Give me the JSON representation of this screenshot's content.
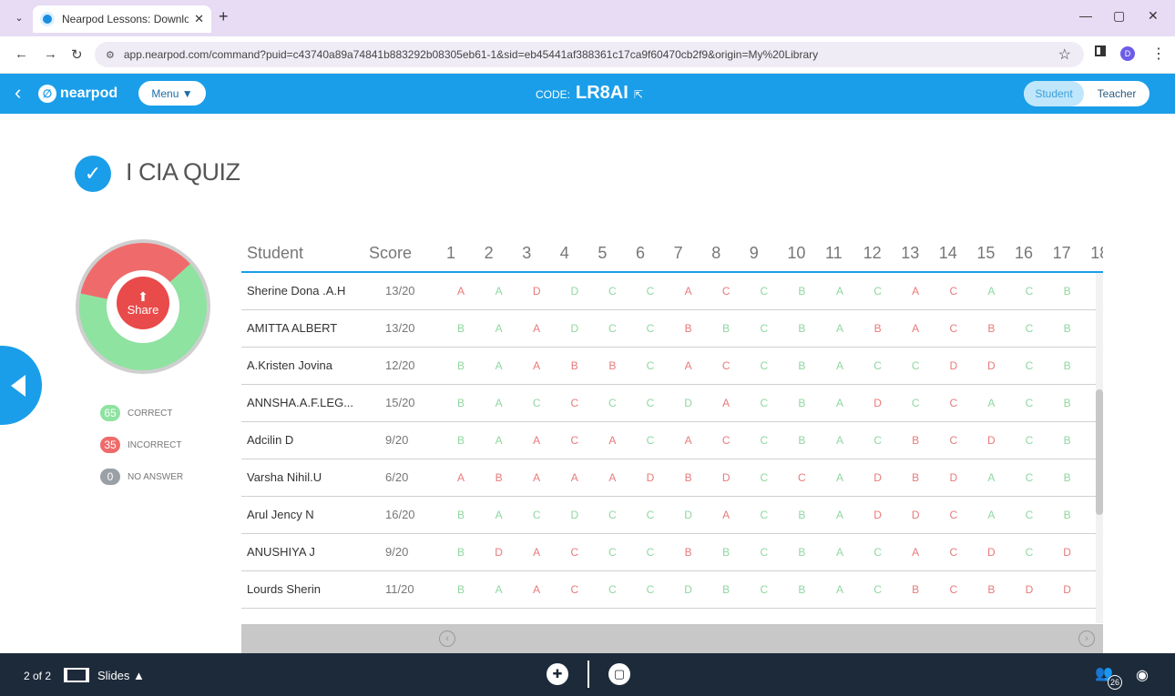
{
  "browser": {
    "tab_title": "Nearpod Lessons: Download re",
    "url": "app.nearpod.com/command?puid=c43740a89a74841b883292b08305eb61-1&sid=eb45441af388361c17ca9f60470cb2f9&origin=My%20Library",
    "profile_initial": "D"
  },
  "header": {
    "logo_text": "nearpod",
    "menu_label": "Menu ▼",
    "code_label": "CODE:",
    "code_value": "LR8AI",
    "mode_student": "Student",
    "mode_teacher": "Teacher"
  },
  "quiz": {
    "title": "I CIA QUIZ",
    "share_label": "Share",
    "stats": {
      "correct_count": "65",
      "correct_label": "CORRECT",
      "incorrect_count": "35",
      "incorrect_label": "INCORRECT",
      "no_answer_count": "0",
      "no_answer_label": "NO ANSWER"
    },
    "colors": {
      "correct": "#8ee3a0",
      "incorrect": "#ef6b6b",
      "no_answer": "#9aa0a6"
    }
  },
  "table": {
    "col_student": "Student",
    "col_score": "Score",
    "questions": [
      "1",
      "2",
      "3",
      "4",
      "5",
      "6",
      "7",
      "8",
      "9",
      "10",
      "11",
      "12",
      "13",
      "14",
      "15",
      "16",
      "17",
      "18"
    ],
    "rows": [
      {
        "name": "Sherine Dona .A.H",
        "score": "13/20",
        "answers": [
          {
            "a": "A",
            "ok": false
          },
          {
            "a": "A",
            "ok": true
          },
          {
            "a": "D",
            "ok": false
          },
          {
            "a": "D",
            "ok": true
          },
          {
            "a": "C",
            "ok": true
          },
          {
            "a": "C",
            "ok": true
          },
          {
            "a": "A",
            "ok": false
          },
          {
            "a": "C",
            "ok": false
          },
          {
            "a": "C",
            "ok": true
          },
          {
            "a": "B",
            "ok": true
          },
          {
            "a": "A",
            "ok": true
          },
          {
            "a": "C",
            "ok": true
          },
          {
            "a": "A",
            "ok": false
          },
          {
            "a": "C",
            "ok": false
          },
          {
            "a": "A",
            "ok": true
          },
          {
            "a": "C",
            "ok": true
          },
          {
            "a": "B",
            "ok": true
          }
        ]
      },
      {
        "name": "AMITTA ALBERT",
        "score": "13/20",
        "answers": [
          {
            "a": "B",
            "ok": true
          },
          {
            "a": "A",
            "ok": true
          },
          {
            "a": "A",
            "ok": false
          },
          {
            "a": "D",
            "ok": true
          },
          {
            "a": "C",
            "ok": true
          },
          {
            "a": "C",
            "ok": true
          },
          {
            "a": "B",
            "ok": false
          },
          {
            "a": "B",
            "ok": true
          },
          {
            "a": "C",
            "ok": true
          },
          {
            "a": "B",
            "ok": true
          },
          {
            "a": "A",
            "ok": true
          },
          {
            "a": "B",
            "ok": false
          },
          {
            "a": "A",
            "ok": false
          },
          {
            "a": "C",
            "ok": false
          },
          {
            "a": "B",
            "ok": false
          },
          {
            "a": "C",
            "ok": true
          },
          {
            "a": "B",
            "ok": true
          }
        ]
      },
      {
        "name": "A.Kristen Jovina",
        "score": "12/20",
        "answers": [
          {
            "a": "B",
            "ok": true
          },
          {
            "a": "A",
            "ok": true
          },
          {
            "a": "A",
            "ok": false
          },
          {
            "a": "B",
            "ok": false
          },
          {
            "a": "B",
            "ok": false
          },
          {
            "a": "C",
            "ok": true
          },
          {
            "a": "A",
            "ok": false
          },
          {
            "a": "C",
            "ok": false
          },
          {
            "a": "C",
            "ok": true
          },
          {
            "a": "B",
            "ok": true
          },
          {
            "a": "A",
            "ok": true
          },
          {
            "a": "C",
            "ok": true
          },
          {
            "a": "C",
            "ok": true
          },
          {
            "a": "D",
            "ok": false
          },
          {
            "a": "D",
            "ok": false
          },
          {
            "a": "C",
            "ok": true
          },
          {
            "a": "B",
            "ok": true
          }
        ]
      },
      {
        "name": "ANNSHA.A.F.LEG...",
        "score": "15/20",
        "answers": [
          {
            "a": "B",
            "ok": true
          },
          {
            "a": "A",
            "ok": true
          },
          {
            "a": "C",
            "ok": true
          },
          {
            "a": "C",
            "ok": false
          },
          {
            "a": "C",
            "ok": true
          },
          {
            "a": "C",
            "ok": true
          },
          {
            "a": "D",
            "ok": true
          },
          {
            "a": "A",
            "ok": false
          },
          {
            "a": "C",
            "ok": true
          },
          {
            "a": "B",
            "ok": true
          },
          {
            "a": "A",
            "ok": true
          },
          {
            "a": "D",
            "ok": false
          },
          {
            "a": "C",
            "ok": true
          },
          {
            "a": "C",
            "ok": false
          },
          {
            "a": "A",
            "ok": true
          },
          {
            "a": "C",
            "ok": true
          },
          {
            "a": "B",
            "ok": true
          }
        ]
      },
      {
        "name": "Adcilin D",
        "score": "9/20",
        "answers": [
          {
            "a": "B",
            "ok": true
          },
          {
            "a": "A",
            "ok": true
          },
          {
            "a": "A",
            "ok": false
          },
          {
            "a": "C",
            "ok": false
          },
          {
            "a": "A",
            "ok": false
          },
          {
            "a": "C",
            "ok": true
          },
          {
            "a": "A",
            "ok": false
          },
          {
            "a": "C",
            "ok": false
          },
          {
            "a": "C",
            "ok": true
          },
          {
            "a": "B",
            "ok": true
          },
          {
            "a": "A",
            "ok": true
          },
          {
            "a": "C",
            "ok": true
          },
          {
            "a": "B",
            "ok": false
          },
          {
            "a": "C",
            "ok": false
          },
          {
            "a": "D",
            "ok": false
          },
          {
            "a": "C",
            "ok": true
          },
          {
            "a": "B",
            "ok": true
          }
        ]
      },
      {
        "name": "Varsha Nihil.U",
        "score": "6/20",
        "answers": [
          {
            "a": "A",
            "ok": false
          },
          {
            "a": "B",
            "ok": false
          },
          {
            "a": "A",
            "ok": false
          },
          {
            "a": "A",
            "ok": false
          },
          {
            "a": "A",
            "ok": false
          },
          {
            "a": "D",
            "ok": false
          },
          {
            "a": "B",
            "ok": false
          },
          {
            "a": "D",
            "ok": false
          },
          {
            "a": "C",
            "ok": true
          },
          {
            "a": "C",
            "ok": false
          },
          {
            "a": "A",
            "ok": true
          },
          {
            "a": "D",
            "ok": false
          },
          {
            "a": "B",
            "ok": false
          },
          {
            "a": "D",
            "ok": false
          },
          {
            "a": "A",
            "ok": true
          },
          {
            "a": "C",
            "ok": true
          },
          {
            "a": "B",
            "ok": true
          }
        ]
      },
      {
        "name": "Arul Jency N",
        "score": "16/20",
        "answers": [
          {
            "a": "B",
            "ok": true
          },
          {
            "a": "A",
            "ok": true
          },
          {
            "a": "C",
            "ok": true
          },
          {
            "a": "D",
            "ok": true
          },
          {
            "a": "C",
            "ok": true
          },
          {
            "a": "C",
            "ok": true
          },
          {
            "a": "D",
            "ok": true
          },
          {
            "a": "A",
            "ok": false
          },
          {
            "a": "C",
            "ok": true
          },
          {
            "a": "B",
            "ok": true
          },
          {
            "a": "A",
            "ok": true
          },
          {
            "a": "D",
            "ok": false
          },
          {
            "a": "D",
            "ok": false
          },
          {
            "a": "C",
            "ok": false
          },
          {
            "a": "A",
            "ok": true
          },
          {
            "a": "C",
            "ok": true
          },
          {
            "a": "B",
            "ok": true
          }
        ]
      },
      {
        "name": "ANUSHIYA J",
        "score": "9/20",
        "answers": [
          {
            "a": "B",
            "ok": true
          },
          {
            "a": "D",
            "ok": false
          },
          {
            "a": "A",
            "ok": false
          },
          {
            "a": "C",
            "ok": false
          },
          {
            "a": "C",
            "ok": true
          },
          {
            "a": "C",
            "ok": true
          },
          {
            "a": "B",
            "ok": false
          },
          {
            "a": "B",
            "ok": true
          },
          {
            "a": "C",
            "ok": true
          },
          {
            "a": "B",
            "ok": true
          },
          {
            "a": "A",
            "ok": true
          },
          {
            "a": "C",
            "ok": true
          },
          {
            "a": "A",
            "ok": false
          },
          {
            "a": "C",
            "ok": false
          },
          {
            "a": "D",
            "ok": false
          },
          {
            "a": "C",
            "ok": true
          },
          {
            "a": "D",
            "ok": false
          }
        ]
      },
      {
        "name": "Lourds Sherin",
        "score": "11/20",
        "answers": [
          {
            "a": "B",
            "ok": true
          },
          {
            "a": "A",
            "ok": true
          },
          {
            "a": "A",
            "ok": false
          },
          {
            "a": "C",
            "ok": false
          },
          {
            "a": "C",
            "ok": true
          },
          {
            "a": "C",
            "ok": true
          },
          {
            "a": "D",
            "ok": true
          },
          {
            "a": "B",
            "ok": true
          },
          {
            "a": "C",
            "ok": true
          },
          {
            "a": "B",
            "ok": true
          },
          {
            "a": "A",
            "ok": true
          },
          {
            "a": "C",
            "ok": true
          },
          {
            "a": "B",
            "ok": false
          },
          {
            "a": "C",
            "ok": false
          },
          {
            "a": "B",
            "ok": false
          },
          {
            "a": "D",
            "ok": false
          },
          {
            "a": "D",
            "ok": false
          }
        ]
      }
    ]
  },
  "footer": {
    "page_count": "2 of 2",
    "slides_label": "Slides ▲",
    "students_count": "26"
  }
}
